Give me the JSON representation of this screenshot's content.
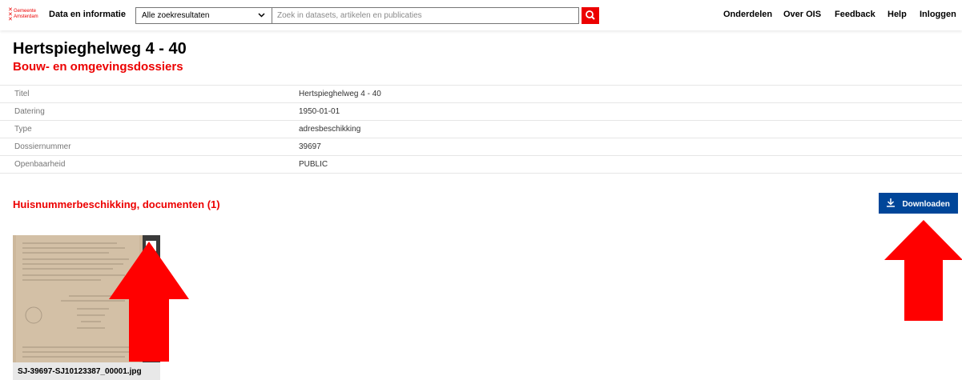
{
  "header": {
    "logo_text": "Gemeente\nAmsterdam",
    "site_title": "Data en informatie",
    "search_scope": "Alle zoekresultaten",
    "search_placeholder": "Zoek in datasets, artikelen en publicaties",
    "nav": [
      "Onderdelen",
      "Over OIS",
      "Feedback",
      "Help",
      "Inloggen"
    ]
  },
  "page": {
    "title": "Hertspieghelweg 4 - 40",
    "subtitle": "Bouw- en omgevingsdossiers"
  },
  "metadata": [
    {
      "key": "Titel",
      "value": "Hertspieghelweg 4 - 40"
    },
    {
      "key": "Datering",
      "value": "1950-01-01"
    },
    {
      "key": "Type",
      "value": "adresbeschikking"
    },
    {
      "key": "Dossiernummer",
      "value": "39697"
    },
    {
      "key": "Openbaarheid",
      "value": "PUBLIC"
    }
  ],
  "documents": {
    "heading": "Huisnummerbeschikking, documenten (1)",
    "download_label": "Downloaden",
    "items": [
      {
        "filename": "SJ-39697-SJ10123387_00001.jpg",
        "selected": false
      }
    ]
  },
  "colors": {
    "brand_red": "#ec0000",
    "button_blue": "#004699",
    "annotation_red": "#ff0000"
  },
  "icons": {
    "search": "search-icon",
    "chevron": "chevron-down-icon",
    "download": "download-icon",
    "checkbox": "checkbox-icon",
    "annotation": "arrow-up-icon"
  }
}
